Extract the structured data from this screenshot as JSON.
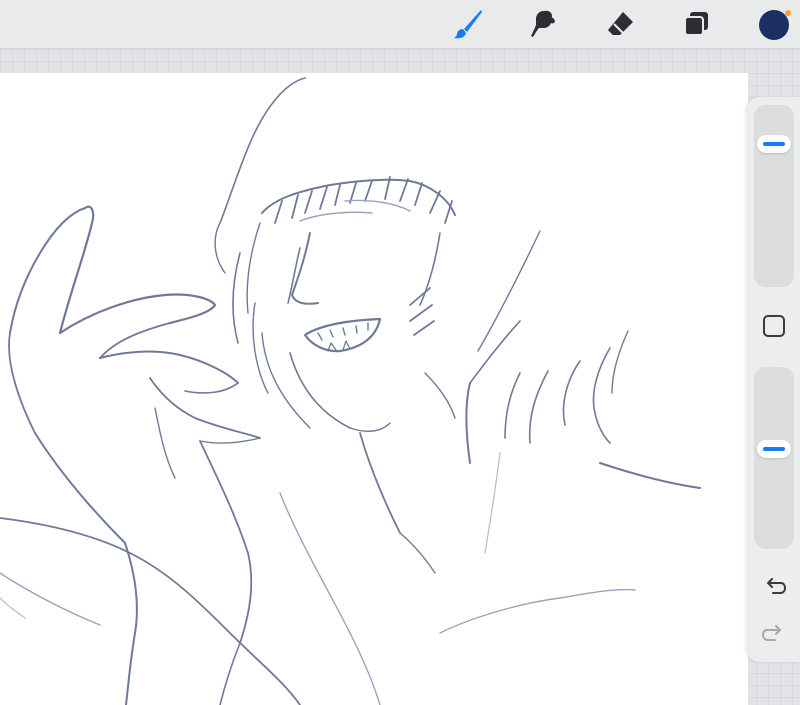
{
  "toolbar": {
    "brush_icon": "brush-icon",
    "smudge_icon": "smudge-icon",
    "eraser_icon": "eraser-icon",
    "layers_icon": "layers-icon",
    "active_color": "#1c2f63",
    "accent_color": "#1a7cf5",
    "notification_dot_color": "#f5a623"
  },
  "sidebar": {
    "brush_size_level": 0.83,
    "opacity_level": 0.56,
    "modify_button_icon": "square-icon",
    "undo_icon": "undo-icon",
    "redo_icon": "redo-icon"
  },
  "sketch": {
    "stroke_color": "#6f7a99"
  }
}
